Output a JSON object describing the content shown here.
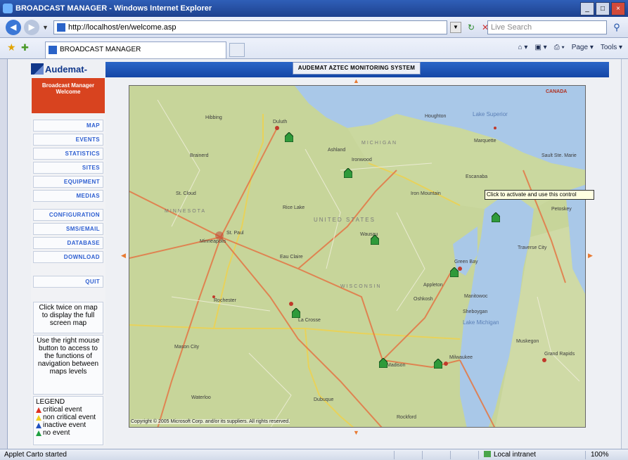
{
  "browser": {
    "window_title": "BROADCAST MANAGER - Windows Internet Explorer",
    "url": "http://localhost/en/welcome.asp",
    "search_placeholder": "Live Search",
    "tab_title": "BROADCAST MANAGER",
    "command_bar": [
      "Page ▾",
      "Tools ▾"
    ],
    "status_text": "Applet Carto started",
    "zone": "Local intranet",
    "zoom": "100%"
  },
  "app": {
    "logo": "Audemat-Aztec",
    "system_title": "AUDEMAT AZTEC MONITORING SYSTEM",
    "user_box": [
      "Broadcast Manager",
      "Welcome",
      ""
    ],
    "menu": [
      {
        "label": "MAP"
      },
      {
        "label": "EVENTS"
      },
      {
        "label": "STATISTICS"
      },
      {
        "label": "SITES"
      },
      {
        "label": "EQUIPMENT"
      },
      {
        "label": "MEDIAS"
      },
      {
        "label": "CONFIGURATION"
      },
      {
        "label": "SMS/EMAIL"
      },
      {
        "label": "DATABASE"
      },
      {
        "label": "DOWNLOAD"
      },
      {
        "label": "QUIT"
      }
    ],
    "help_map": "Click twice on map to display the full screen map",
    "help_nav": "Use the right mouse button to access to the functions of navigation between maps levels",
    "legend": {
      "title": "LEGEND",
      "items": [
        {
          "label": "critical event",
          "color": "#e03020"
        },
        {
          "label": "non critical event",
          "color": "#f0d020"
        },
        {
          "label": "inactive event",
          "color": "#2050c0"
        },
        {
          "label": "no event",
          "color": "#20a040"
        }
      ]
    }
  },
  "map": {
    "tooltip": "Click to activate and use this control",
    "copyright": "Copyright © 2005 Microsoft Corp. and/or its suppliers. All rights reserved.",
    "labels": {
      "canada": "CANADA",
      "lake_superior": "Lake Superior",
      "lake_michigan": "Lake Michigan",
      "minnesota": "MINNESOTA",
      "united_states": "UNITED STATES",
      "michigan": "MICHIGAN",
      "wisconsin": "WISCONSIN",
      "duluth": "Duluth",
      "minneapolis": "Minneapolis",
      "st_paul": "St. Paul",
      "green_bay": "Green Bay",
      "milwaukee": "Milwaukee",
      "madison": "Madison",
      "marquette": "Marquette",
      "wausau": "Wausau",
      "la_crosse": "La Crosse",
      "eau_claire": "Eau Claire",
      "rochester": "Rochester",
      "dubuque": "Dubuque",
      "rockford": "Rockford",
      "muskegon": "Muskegon",
      "grand_rapids": "Grand Rapids",
      "traverse_city": "Traverse City",
      "escanaba": "Escanaba",
      "ashland": "Ashland",
      "ironwood": "Ironwood",
      "sault": "Sault Ste. Marie",
      "petoskey": "Petoskey",
      "sheboygan": "Sheboygan",
      "manitowoc": "Manitowoc",
      "oshkosh": "Oshkosh",
      "appleton": "Appleton",
      "mason_city": "Mason City",
      "waterloo": "Waterloo",
      "st_cloud": "St. Cloud",
      "brainerd": "Brainerd",
      "hibbing": "Hibbing",
      "rice_lake": "Rice Lake",
      "houghton": "Houghton",
      "iron_mountain": "Iron Mountain"
    },
    "pins_status": [
      "no event",
      "no event",
      "no event",
      "no event",
      "no event",
      "no event",
      "no event",
      "no event"
    ]
  }
}
